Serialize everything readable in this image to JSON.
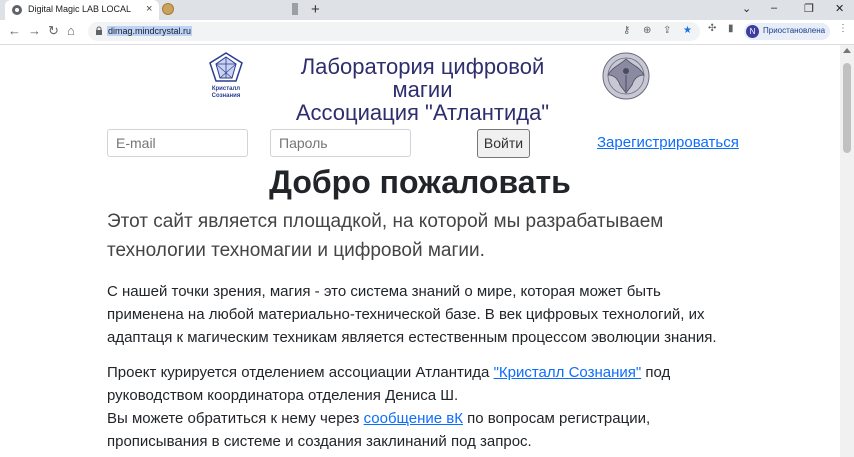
{
  "browser": {
    "tab_title": "Digital Magic LAB LOCAL",
    "tab_close": "×",
    "new_tab": "+",
    "url": "dimag.mindcrystal.ru",
    "profile_initial": "N",
    "profile_label": "Приостановлена",
    "win_minimize": "–",
    "win_restore": "❐",
    "win_close": "✕"
  },
  "header": {
    "title_line1": "Лаборатория цифровой",
    "title_line2": "магии",
    "title_line3": "Ассоциация \"Атлантида\"",
    "logo_left_text1": "Кристалл",
    "logo_left_text2": "Сознания"
  },
  "login": {
    "email_placeholder": "E-mail",
    "password_placeholder": "Пароль",
    "login_button": "Войти",
    "register_link": "Зарегистрироваться"
  },
  "content": {
    "welcome": "Добро пожаловать",
    "lead": "Этот сайт является площадкой, на которой мы разрабатываем технологии техномагии и цифровой магии.",
    "para1": "С нашей точки зрения, магия - это система знаний о мире, которая может быть применена на любой материально-технической базе. В век цифровых технологий, их адаптаця к магическим техникам является естественным процессом эволюции знания.",
    "para2_before": "Проект курируется отделением ассоциации Атлантида ",
    "para2_link": "\"Кристалл Сознания\"",
    "para2_after": " под руководством координатора отделения Дениса Ш.",
    "para3_before": "Вы можете обратиться к нему через ",
    "para3_link": "сообщение вК",
    "para3_after": " по вопросам регистрации, прописывания в системе и создания заклинаний под запрос."
  }
}
